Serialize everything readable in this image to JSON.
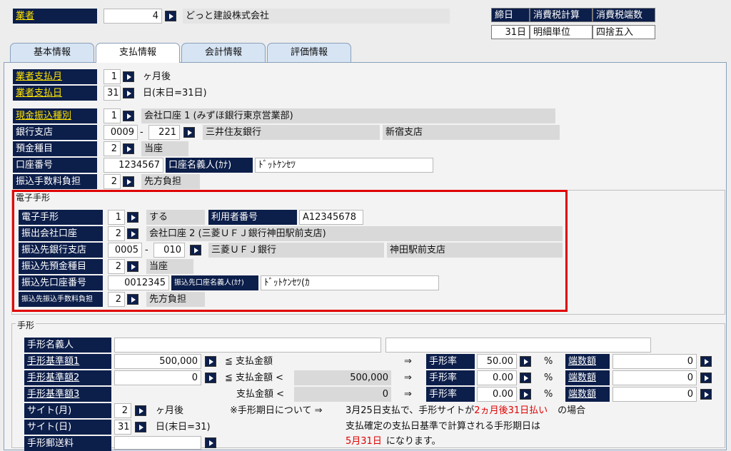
{
  "vendor": {
    "label": "業者",
    "code": "4",
    "name": "どっと建設株式会社"
  },
  "summary": {
    "headers": [
      "締日",
      "消費税計算",
      "消費税端数"
    ],
    "values": [
      "31日",
      "明細単位",
      "四捨五入"
    ]
  },
  "tabs": [
    "基本情報",
    "支払情報",
    "会計情報",
    "評価情報"
  ],
  "payment": {
    "month_label": "業者支払月",
    "month_value": "1",
    "month_unit": "ヶ月後",
    "day_label": "業者支払日",
    "day_value": "31",
    "day_unit": "日(末日=31日)",
    "cash_type_label": "現金振込種別",
    "cash_type_value": "1",
    "cash_type_name": "会社口座 1 (みずほ銀行東京営業部)",
    "bank_label": "銀行支店",
    "bank_code": "0009",
    "bank_dash": "-",
    "branch_code": "221",
    "bank_name": "三井住友銀行",
    "branch_name": "新宿支店",
    "deposit_type_label": "預金種目",
    "deposit_type_value": "2",
    "deposit_type_name": "当座",
    "account_label": "口座番号",
    "account_value": "1234567",
    "holder_label": "口座名義人(ｶﾅ)",
    "holder_value": "ﾄﾞｯﾄｹﾝｾﾂ",
    "fee_label": "振込手数料負担",
    "fee_value": "2",
    "fee_name": "先方負担"
  },
  "denshi": {
    "group_title": "電子手形",
    "flag_label": "電子手形",
    "flag_value": "1",
    "flag_name": "する",
    "user_no_label": "利用者番号",
    "user_no_value": "A12345678",
    "out_account_label": "振出会社口座",
    "out_account_value": "2",
    "out_account_name": "会社口座 2 (三菱ＵＦＪ銀行神田駅前支店)",
    "dest_bank_label": "振込先銀行支店",
    "dest_bank_code": "0005",
    "dest_dash": "-",
    "dest_branch_code": "010",
    "dest_bank_name": "三菱ＵＦＪ銀行",
    "dest_branch_name": "神田駅前支店",
    "dest_deposit_label": "振込先預金種目",
    "dest_deposit_value": "2",
    "dest_deposit_name": "当座",
    "dest_account_label": "振込先口座番号",
    "dest_account_value": "0012345",
    "dest_holder_label": "振込先口座名義人(ｶﾅ)",
    "dest_holder_value": "ﾄﾞｯﾄｹﾝｾﾂ(ｶ",
    "dest_fee_label": "振込先振込手数料負担",
    "dest_fee_value": "2",
    "dest_fee_name": "先方負担"
  },
  "tegata": {
    "group_title": "手形",
    "holder_label": "手形名義人",
    "std1_label": "手形基準額1",
    "std1_value": "500,000",
    "std1_op": "≦ 支払金額",
    "std2_label": "手形基準額2",
    "std2_value": "0",
    "std2_op": "≦ 支払金額 <",
    "std2_bound": "500,000",
    "std3_label": "手形基準額3",
    "std3_op": "支払金額 <",
    "std3_bound": "0",
    "arrow": "⇒",
    "rate_label": "手形率",
    "rate_unit": "%",
    "rates": [
      "50.00",
      "0.00",
      "0.00"
    ],
    "frac_label": "端数額",
    "fracs": [
      "0",
      "0",
      "0"
    ],
    "site_month_label": "サイト(月)",
    "site_month_value": "2",
    "site_month_unit": "ヶ月後",
    "site_day_label": "サイト(日)",
    "site_day_value": "31",
    "site_day_unit": "日(末日=31)",
    "postage_label": "手形郵送料",
    "note_head": "※手形期日について ⇒",
    "note_a": "3月25日支払で、手形サイトが",
    "note_a_red": "2ヵ月後31日払い",
    "note_a_tail": "の場合",
    "note_b": "支払確定の支払日基準で計算される手形期日は",
    "note_c_red": "5月31日",
    "note_c_tail": "になります。"
  },
  "colors": {
    "label_bg": "#0c1e4a",
    "highlight": "#e00000",
    "label_yellow": "#ffe400"
  }
}
